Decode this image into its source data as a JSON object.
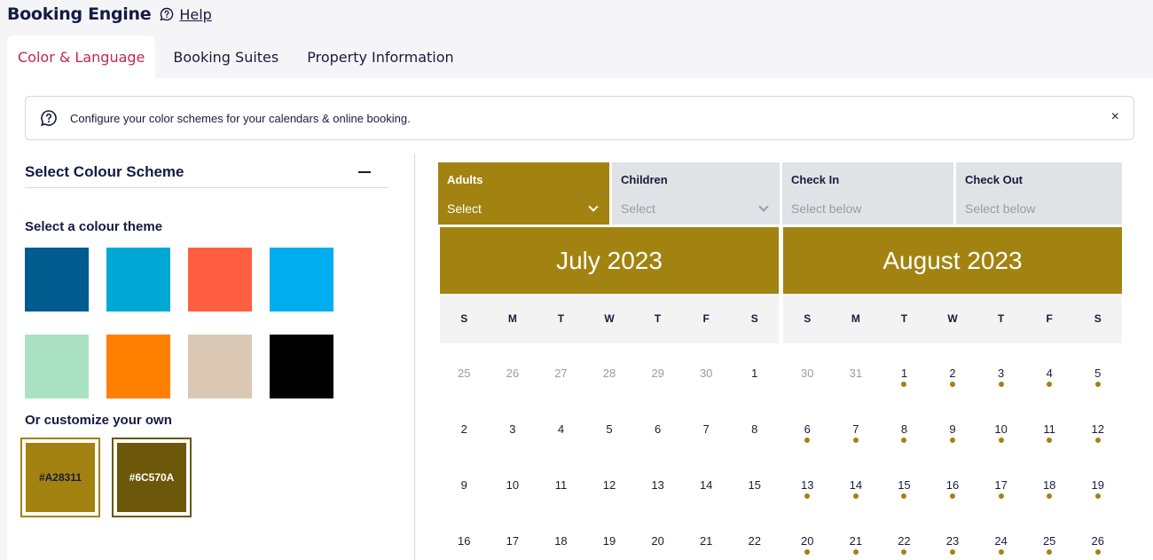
{
  "app": {
    "title": "Booking Engine",
    "help_label": "Help"
  },
  "tabs": [
    {
      "label": "Color & Language",
      "active": true
    },
    {
      "label": "Booking Suites",
      "active": false
    },
    {
      "label": "Property Information",
      "active": false
    }
  ],
  "banner": {
    "text": "Configure your color schemes for your calendars & online booking.",
    "close": "×"
  },
  "color_panel": {
    "title": "Select Colour Scheme",
    "theme_label": "Select a colour theme",
    "themes": [
      "#005b8f",
      "#00a8d6",
      "#ff5f40",
      "#00aeef",
      "#abe1c3",
      "#ff7f00",
      "#dbc8b4",
      "#000000"
    ],
    "custom_label": "Or customize your own",
    "custom_colors": [
      {
        "hex": "#A28311",
        "text_color": "#1b1b3a"
      },
      {
        "hex": "#6C570A",
        "text_color": "#ffffff"
      }
    ]
  },
  "booking": {
    "accent": "#a28311",
    "dot_color": "#a28311",
    "fields": [
      {
        "label": "Adults",
        "value": "Select",
        "has_chevron": true,
        "active": true
      },
      {
        "label": "Children",
        "value": "Select",
        "has_chevron": true,
        "active": false
      },
      {
        "label": "Check In",
        "value": "Select below",
        "has_chevron": false,
        "active": false
      },
      {
        "label": "Check Out",
        "value": "Select below",
        "has_chevron": false,
        "active": false
      }
    ],
    "weekdays": [
      "S",
      "M",
      "T",
      "W",
      "T",
      "F",
      "S"
    ],
    "months": [
      {
        "title": "July 2023",
        "weeks": [
          [
            {
              "d": "25",
              "m": true
            },
            {
              "d": "26",
              "m": true
            },
            {
              "d": "27",
              "m": true
            },
            {
              "d": "28",
              "m": true
            },
            {
              "d": "29",
              "m": true
            },
            {
              "d": "30",
              "m": true
            },
            {
              "d": "1"
            }
          ],
          [
            {
              "d": "2"
            },
            {
              "d": "3"
            },
            {
              "d": "4"
            },
            {
              "d": "5"
            },
            {
              "d": "6"
            },
            {
              "d": "7"
            },
            {
              "d": "8"
            }
          ],
          [
            {
              "d": "9"
            },
            {
              "d": "10"
            },
            {
              "d": "11"
            },
            {
              "d": "12"
            },
            {
              "d": "13"
            },
            {
              "d": "14"
            },
            {
              "d": "15"
            }
          ],
          [
            {
              "d": "16"
            },
            {
              "d": "17"
            },
            {
              "d": "18"
            },
            {
              "d": "19"
            },
            {
              "d": "20"
            },
            {
              "d": "21"
            },
            {
              "d": "22"
            }
          ]
        ]
      },
      {
        "title": "August 2023",
        "weeks": [
          [
            {
              "d": "30",
              "m": true
            },
            {
              "d": "31",
              "m": true
            },
            {
              "d": "1",
              "dot": true
            },
            {
              "d": "2",
              "dot": true
            },
            {
              "d": "3",
              "dot": true
            },
            {
              "d": "4",
              "dot": true
            },
            {
              "d": "5",
              "dot": true
            }
          ],
          [
            {
              "d": "6",
              "dot": true
            },
            {
              "d": "7",
              "dot": true
            },
            {
              "d": "8",
              "dot": true
            },
            {
              "d": "9",
              "dot": true
            },
            {
              "d": "10",
              "dot": true
            },
            {
              "d": "11",
              "dot": true
            },
            {
              "d": "12",
              "dot": true
            }
          ],
          [
            {
              "d": "13",
              "dot": true
            },
            {
              "d": "14",
              "dot": true
            },
            {
              "d": "15",
              "dot": true
            },
            {
              "d": "16",
              "dot": true
            },
            {
              "d": "17",
              "dot": true
            },
            {
              "d": "18",
              "dot": true
            },
            {
              "d": "19",
              "dot": true
            }
          ],
          [
            {
              "d": "20",
              "dot": true
            },
            {
              "d": "21",
              "dot": true
            },
            {
              "d": "22",
              "dot": true
            },
            {
              "d": "23",
              "dot": true
            },
            {
              "d": "24",
              "dot": true
            },
            {
              "d": "25",
              "dot": true
            },
            {
              "d": "26",
              "dot": true
            }
          ]
        ]
      }
    ]
  }
}
